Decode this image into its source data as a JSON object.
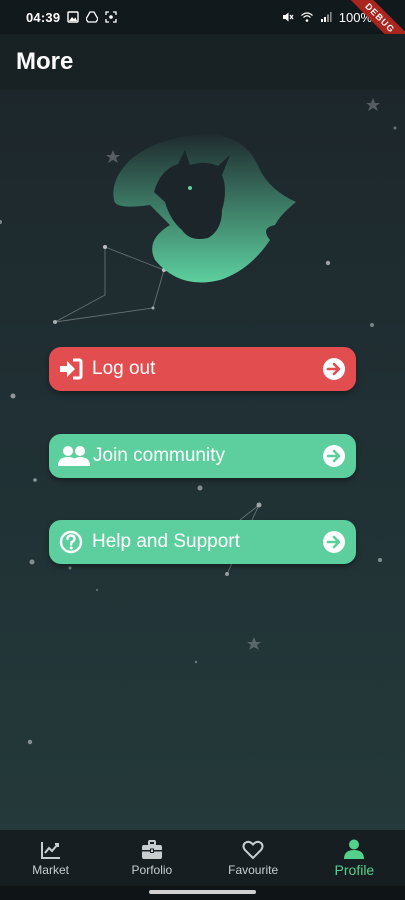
{
  "status_bar": {
    "time": "04:39",
    "battery": "100%",
    "left_icons": [
      "image-icon",
      "drive-icon",
      "screenshot-icon"
    ],
    "right_icons": [
      "mute-icon",
      "wifi-icon",
      "signal-icon",
      "battery-icon"
    ]
  },
  "debug_banner": "DEBUG",
  "appbar": {
    "title": "More"
  },
  "buttons": {
    "logout": {
      "label": "Log out",
      "icon": "login-icon",
      "color": "#e24d4f"
    },
    "community": {
      "label": "Join community",
      "icon": "users-icon",
      "color": "#5dcf9f"
    },
    "help": {
      "label": "Help and Support",
      "icon": "question-circle-icon",
      "color": "#5dcf9f"
    }
  },
  "nav": {
    "items": [
      {
        "label": "Market",
        "icon": "chart-line-icon"
      },
      {
        "label": "Porfolio",
        "icon": "briefcase-icon"
      },
      {
        "label": "Favourite",
        "icon": "heart-icon"
      },
      {
        "label": "Profile",
        "icon": "user-icon"
      }
    ],
    "active": "Profile",
    "active_color": "#55d08a"
  },
  "colors": {
    "accent": "#5dcf9f",
    "danger": "#e24d4f",
    "background": "#1d272b"
  }
}
